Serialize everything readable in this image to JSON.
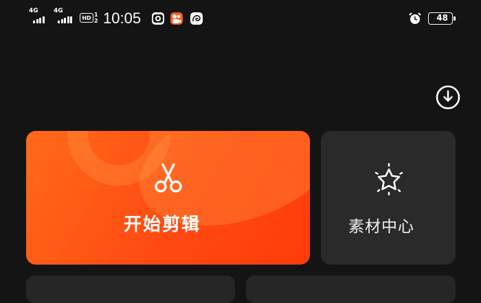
{
  "status_bar": {
    "signal_1": "4G",
    "signal_2": "4G",
    "hd": "HD",
    "hd_sub": "1 2",
    "time": "10:05",
    "battery": "48"
  },
  "cards": {
    "start_edit": {
      "label": "开始剪辑",
      "icon": "scissors-icon"
    },
    "material_center": {
      "label": "素材中心",
      "icon": "sparkle-star-icon"
    }
  },
  "colors": {
    "background": "#141414",
    "accent": "#ff4a12",
    "card_dark": "#2a2a2a"
  }
}
